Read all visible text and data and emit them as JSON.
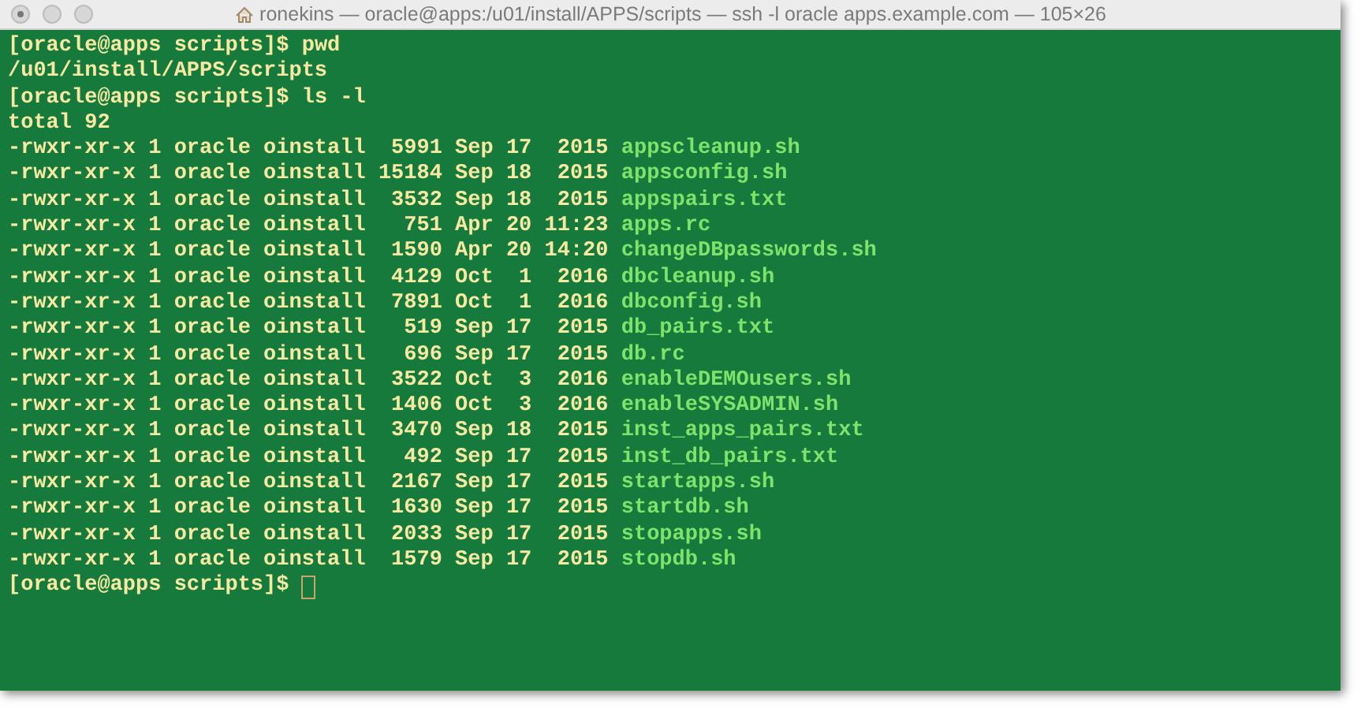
{
  "window": {
    "title": "ronekins — oracle@apps:/u01/install/APPS/scripts — ssh -l oracle apps.example.com — 105×26"
  },
  "lines": [
    {
      "kind": "prompt",
      "prompt": "[oracle@apps scripts]$",
      "command": "pwd"
    },
    {
      "kind": "output",
      "text": "/u01/install/APPS/scripts"
    },
    {
      "kind": "prompt",
      "prompt": "[oracle@apps scripts]$",
      "command": "ls -l"
    },
    {
      "kind": "output",
      "text": "total 92"
    },
    {
      "kind": "file",
      "details": "-rwxr-xr-x 1 oracle oinstall  5991 Sep 17  2015",
      "name": "appscleanup.sh"
    },
    {
      "kind": "file",
      "details": "-rwxr-xr-x 1 oracle oinstall 15184 Sep 18  2015",
      "name": "appsconfig.sh"
    },
    {
      "kind": "file",
      "details": "-rwxr-xr-x 1 oracle oinstall  3532 Sep 18  2015",
      "name": "appspairs.txt"
    },
    {
      "kind": "file",
      "details": "-rwxr-xr-x 1 oracle oinstall   751 Apr 20 11:23",
      "name": "apps.rc"
    },
    {
      "kind": "file",
      "details": "-rwxr-xr-x 1 oracle oinstall  1590 Apr 20 14:20",
      "name": "changeDBpasswords.sh"
    },
    {
      "kind": "file",
      "details": "-rwxr-xr-x 1 oracle oinstall  4129 Oct  1  2016",
      "name": "dbcleanup.sh"
    },
    {
      "kind": "file",
      "details": "-rwxr-xr-x 1 oracle oinstall  7891 Oct  1  2016",
      "name": "dbconfig.sh"
    },
    {
      "kind": "file",
      "details": "-rwxr-xr-x 1 oracle oinstall   519 Sep 17  2015",
      "name": "db_pairs.txt"
    },
    {
      "kind": "file",
      "details": "-rwxr-xr-x 1 oracle oinstall   696 Sep 17  2015",
      "name": "db.rc"
    },
    {
      "kind": "file",
      "details": "-rwxr-xr-x 1 oracle oinstall  3522 Oct  3  2016",
      "name": "enableDEMOusers.sh"
    },
    {
      "kind": "file",
      "details": "-rwxr-xr-x 1 oracle oinstall  1406 Oct  3  2016",
      "name": "enableSYSADMIN.sh"
    },
    {
      "kind": "file",
      "details": "-rwxr-xr-x 1 oracle oinstall  3470 Sep 18  2015",
      "name": "inst_apps_pairs.txt"
    },
    {
      "kind": "file",
      "details": "-rwxr-xr-x 1 oracle oinstall   492 Sep 17  2015",
      "name": "inst_db_pairs.txt"
    },
    {
      "kind": "file",
      "details": "-rwxr-xr-x 1 oracle oinstall  2167 Sep 17  2015",
      "name": "startapps.sh"
    },
    {
      "kind": "file",
      "details": "-rwxr-xr-x 1 oracle oinstall  1630 Sep 17  2015",
      "name": "startdb.sh"
    },
    {
      "kind": "file",
      "details": "-rwxr-xr-x 1 oracle oinstall  2033 Sep 17  2015",
      "name": "stopapps.sh"
    },
    {
      "kind": "file",
      "details": "-rwxr-xr-x 1 oracle oinstall  1579 Sep 17  2015",
      "name": "stopdb.sh"
    },
    {
      "kind": "prompt",
      "prompt": "[oracle@apps scripts]$",
      "cursor": true
    }
  ]
}
